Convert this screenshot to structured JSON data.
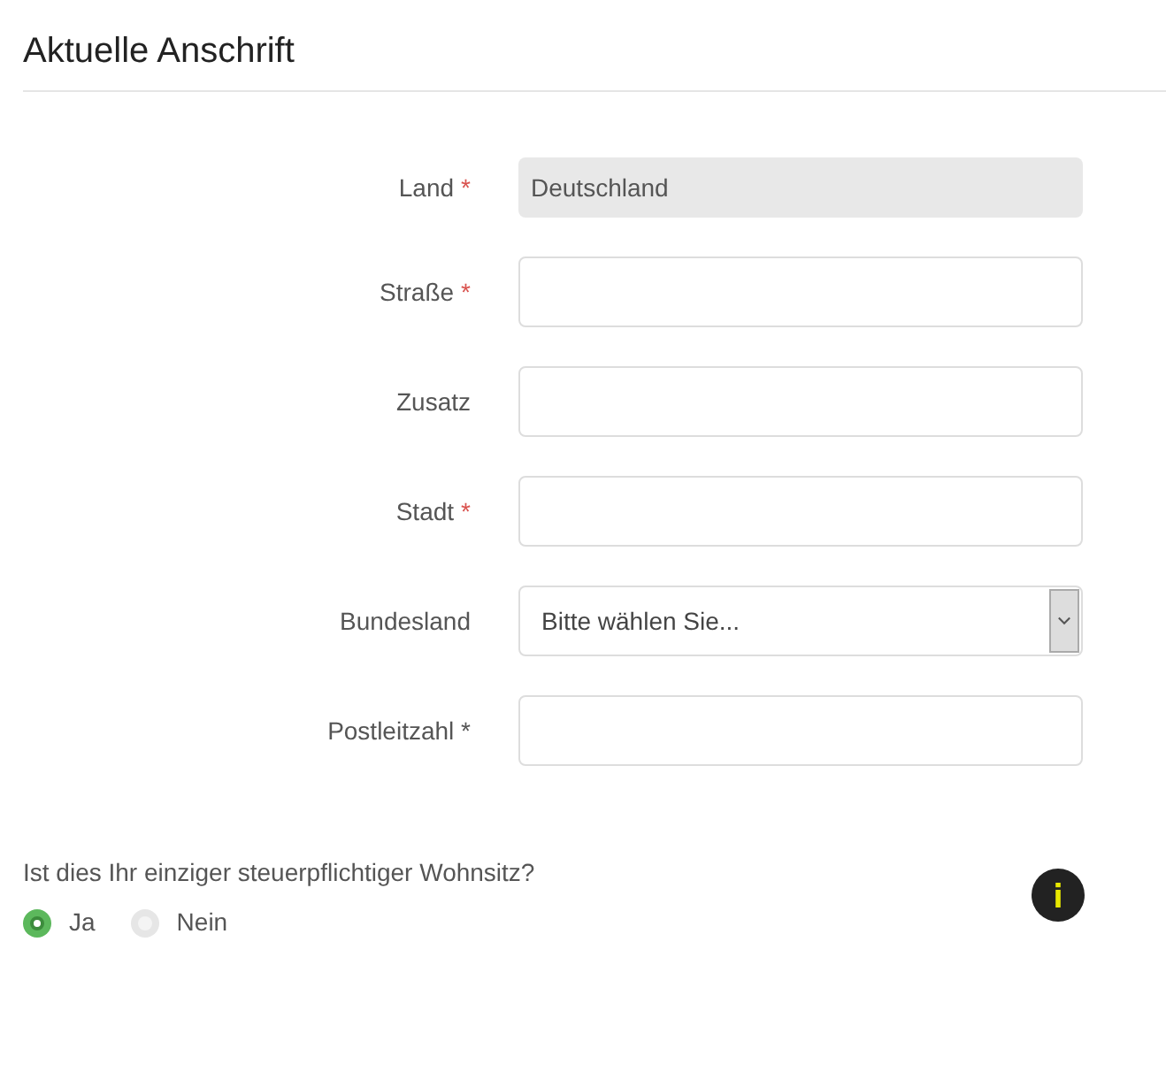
{
  "title": "Aktuelle Anschrift",
  "fields": [
    {
      "kind": "input",
      "label": "Land",
      "required_mark": "*",
      "value": "Deutschland",
      "disabled": true
    },
    {
      "kind": "input",
      "label": "Straße",
      "required_mark": "*",
      "disabled": false
    },
    {
      "kind": "input",
      "label": "Zusatz",
      "disabled": false
    },
    {
      "kind": "input",
      "label": "Stadt",
      "required_mark": "*",
      "disabled": false
    },
    {
      "kind": "select",
      "label": "Bundesland",
      "value": "Bitte wählen Sie..."
    },
    {
      "kind": "input",
      "label": "Postleitzahl *",
      "disabled": false
    }
  ],
  "question": {
    "text": "Ist dies Ihr einziger steuerpflichtiger Wohnsitz?",
    "options": [
      {
        "label": "Ja",
        "selected": true
      },
      {
        "label": "Nein",
        "selected": false
      }
    ]
  }
}
